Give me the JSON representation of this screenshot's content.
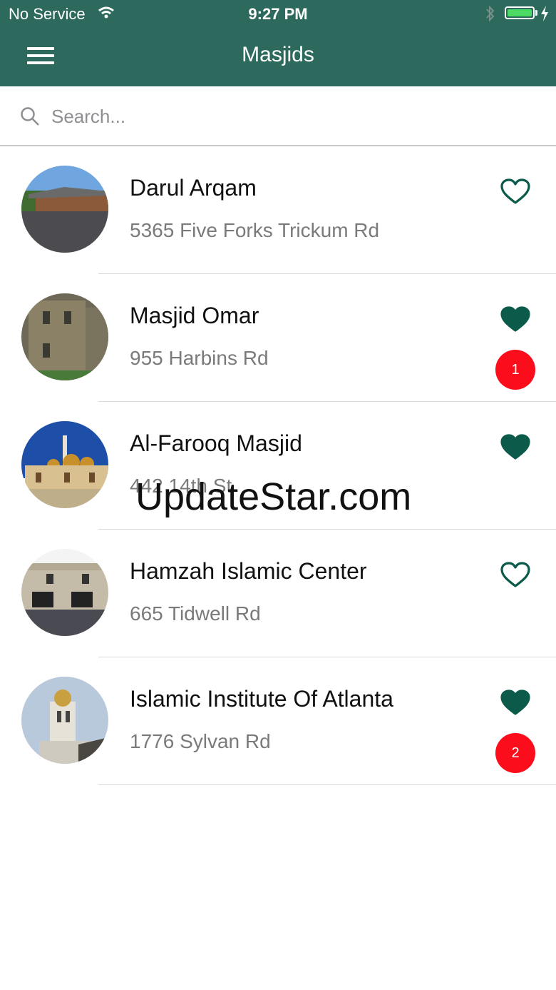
{
  "status_bar": {
    "carrier": "No Service",
    "time": "9:27 PM"
  },
  "header": {
    "title": "Masjids"
  },
  "search": {
    "placeholder": "Search..."
  },
  "masjids": [
    {
      "name": "Darul Arqam",
      "address": "5365 Five Forks Trickum Rd",
      "favorited": false
    },
    {
      "name": "Masjid Omar",
      "address": "955 Harbins Rd",
      "favorited": true,
      "badge": "1"
    },
    {
      "name": "Al-Farooq Masjid",
      "address": "442 14th St",
      "favorited": true
    },
    {
      "name": "Hamzah Islamic Center",
      "address": "665 Tidwell Rd",
      "favorited": false
    },
    {
      "name": "Islamic Institute Of Atlanta",
      "address": "1776 Sylvan Rd",
      "favorited": true,
      "badge": "2"
    }
  ],
  "watermark": "UpdateStar.com",
  "colors": {
    "header": "#2d6a5d",
    "heart": "#0b5a4a",
    "badge": "#fc0d1b"
  },
  "icons": {
    "menu": "hamburger-icon",
    "search": "search-icon",
    "favorite": "heart-icon"
  }
}
